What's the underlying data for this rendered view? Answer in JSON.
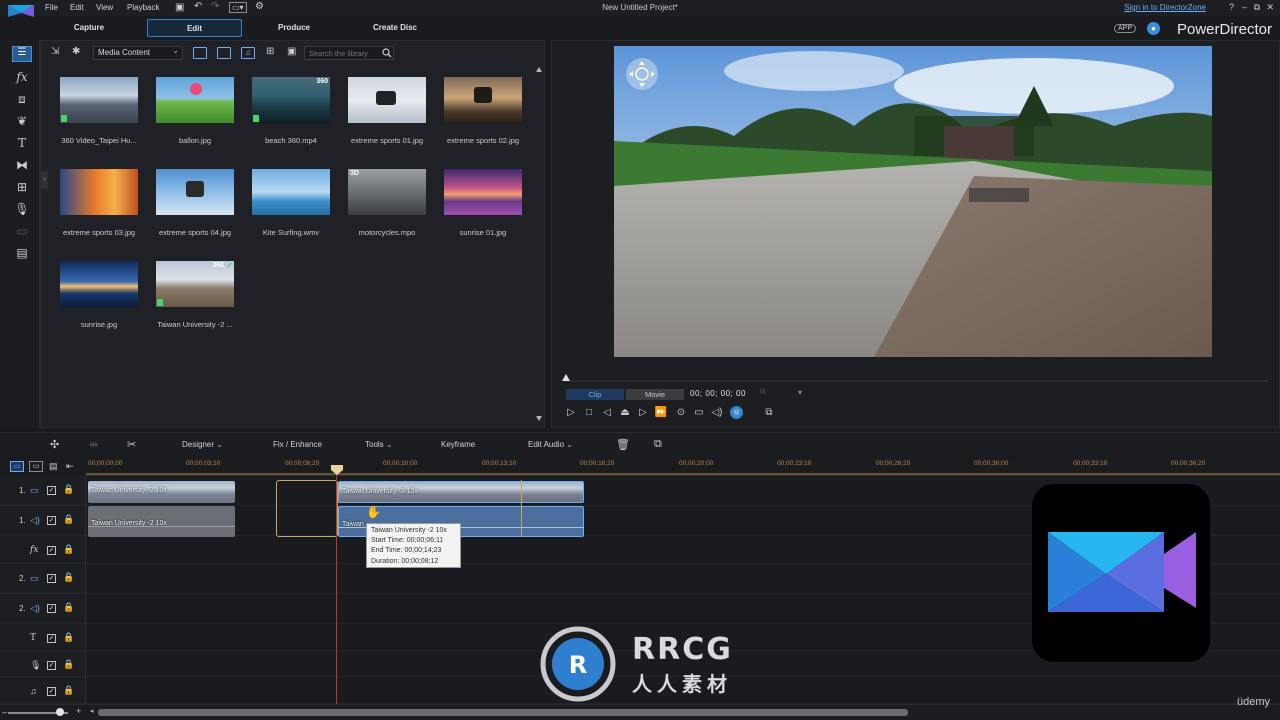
{
  "app": {
    "project_title": "New Untitled Project*",
    "brand_name": "PowerDirector",
    "app_badge": "APP",
    "signin_link": "Sign in to DirectorZone",
    "help": "?"
  },
  "menu": [
    "File",
    "Edit",
    "View",
    "Playback"
  ],
  "modes": {
    "tabs": [
      "Capture",
      "Edit",
      "Produce",
      "Create Disc"
    ],
    "active": "Edit"
  },
  "library": {
    "filter_value": "Media Content",
    "search_placeholder": "Search the library",
    "items": [
      {
        "label": "360 Video_Taipei Hu...",
        "badge": ""
      },
      {
        "label": "ballon.jpg",
        "badge": ""
      },
      {
        "label": "beach 360.mp4",
        "badge": "360"
      },
      {
        "label": "extreme sports 01.jpg",
        "badge": ""
      },
      {
        "label": "extreme sports 02.jpg",
        "badge": ""
      },
      {
        "label": "extreme sports 03.jpg",
        "badge": ""
      },
      {
        "label": "extreme sports 04.jpg",
        "badge": ""
      },
      {
        "label": "Kite Surfing.wmv",
        "badge": ""
      },
      {
        "label": "motorcycles.mpo",
        "badge": "3D"
      },
      {
        "label": "sunrise 01.jpg",
        "badge": ""
      },
      {
        "label": "sunrise.jpg",
        "badge": ""
      },
      {
        "label": "Taiwan University -2 ...",
        "badge": "360"
      }
    ]
  },
  "preview": {
    "tab_clip": "Clip",
    "tab_movie": "Movie",
    "timecode": "00; 00; 00; 00",
    "fps_hint": "f4"
  },
  "timeline_toolbar": {
    "designer": "Designer",
    "fix_enhance": "Fix / Enhance",
    "tools": "Tools",
    "keyframe": "Keyframe",
    "edit_audio": "Edit Audio"
  },
  "ruler": {
    "ticks": [
      "00;00;00;00",
      "00;00;03;10",
      "00;00;06;20",
      "00;00;10;00",
      "00;00;13;10",
      "00;00;16;20",
      "00;00;20;00",
      "00;00;23;10",
      "00;00;26;20",
      "00;00;30;00",
      "00;00;33;10",
      "00;00;36;20"
    ]
  },
  "tracks": [
    {
      "num": "1.",
      "type": "video-track-icon"
    },
    {
      "num": "1.",
      "type": "audio-track-icon"
    },
    {
      "num": "",
      "type": "fx-track-icon"
    },
    {
      "num": "2.",
      "type": "video-track-icon"
    },
    {
      "num": "2.",
      "type": "audio-track-icon"
    },
    {
      "num": "",
      "type": "title-track-icon"
    },
    {
      "num": "",
      "type": "voice-track-icon"
    },
    {
      "num": "",
      "type": "music-track-icon"
    }
  ],
  "clips": {
    "video_label": "Taiwan University -2 10x",
    "audio_label": "Taiwan University -2 10x",
    "audio_label_short": "Taiwan"
  },
  "tooltip": {
    "name": "Taiwan University -2 10x",
    "start": "Start Time: 00;00;06;11",
    "end": "End Time: 00;00;14;23",
    "duration": "Duration: 00;00;08;12"
  },
  "watermark": {
    "text": "RRCG",
    "sub": "人人素材"
  },
  "udemy": "üdemy",
  "colors": {
    "accent": "#2f86c8",
    "link": "#6aaef5",
    "playhead": "#c0332e",
    "clip_audio": "#4a6f9c"
  }
}
